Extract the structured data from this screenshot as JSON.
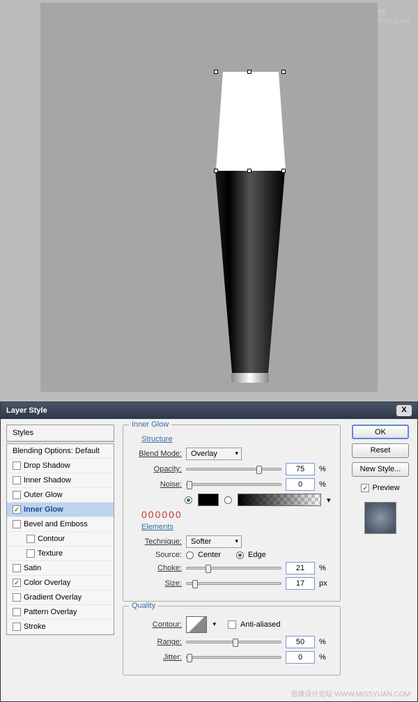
{
  "watermark": {
    "top_main": "火星时代",
    "top_sub": "WWW.HXSD.COM",
    "bottom": "思缘设计论坛  WWW.MISSYUAN.COM"
  },
  "dialog": {
    "title": "Layer Style",
    "close": "X",
    "styles_header": "Styles",
    "blending_options": "Blending Options: Default",
    "items": [
      {
        "label": "Drop Shadow",
        "checked": false
      },
      {
        "label": "Inner Shadow",
        "checked": false
      },
      {
        "label": "Outer Glow",
        "checked": false
      },
      {
        "label": "Inner Glow",
        "checked": true,
        "selected": true
      },
      {
        "label": "Bevel and Emboss",
        "checked": false
      },
      {
        "label": "Contour",
        "checked": false,
        "sub": true
      },
      {
        "label": "Texture",
        "checked": false,
        "sub": true
      },
      {
        "label": "Satin",
        "checked": false
      },
      {
        "label": "Color Overlay",
        "checked": true
      },
      {
        "label": "Gradient Overlay",
        "checked": false
      },
      {
        "label": "Pattern Overlay",
        "checked": false
      },
      {
        "label": "Stroke",
        "checked": false
      }
    ]
  },
  "panel": {
    "title": "Inner Glow",
    "structure_title": "Structure",
    "blend_mode_label": "Blend Mode:",
    "blend_mode_value": "Overlay",
    "opacity_label": "Opacity:",
    "opacity_value": "75",
    "noise_label": "Noise:",
    "noise_value": "0",
    "percent": "%",
    "px": "px",
    "color_code": "000000",
    "elements_title": "Elements",
    "technique_label": "Technique:",
    "technique_value": "Softer",
    "source_label": "Source:",
    "source_center": "Center",
    "source_edge": "Edge",
    "choke_label": "Choke:",
    "choke_value": "21",
    "size_label": "Size:",
    "size_value": "17",
    "quality_title": "Quality",
    "contour_label": "Contour:",
    "antialiased_label": "Anti-aliased",
    "range_label": "Range:",
    "range_value": "50",
    "jitter_label": "Jitter:",
    "jitter_value": "0"
  },
  "buttons": {
    "ok": "OK",
    "reset": "Reset",
    "new_style": "New Style...",
    "preview": "Preview"
  }
}
